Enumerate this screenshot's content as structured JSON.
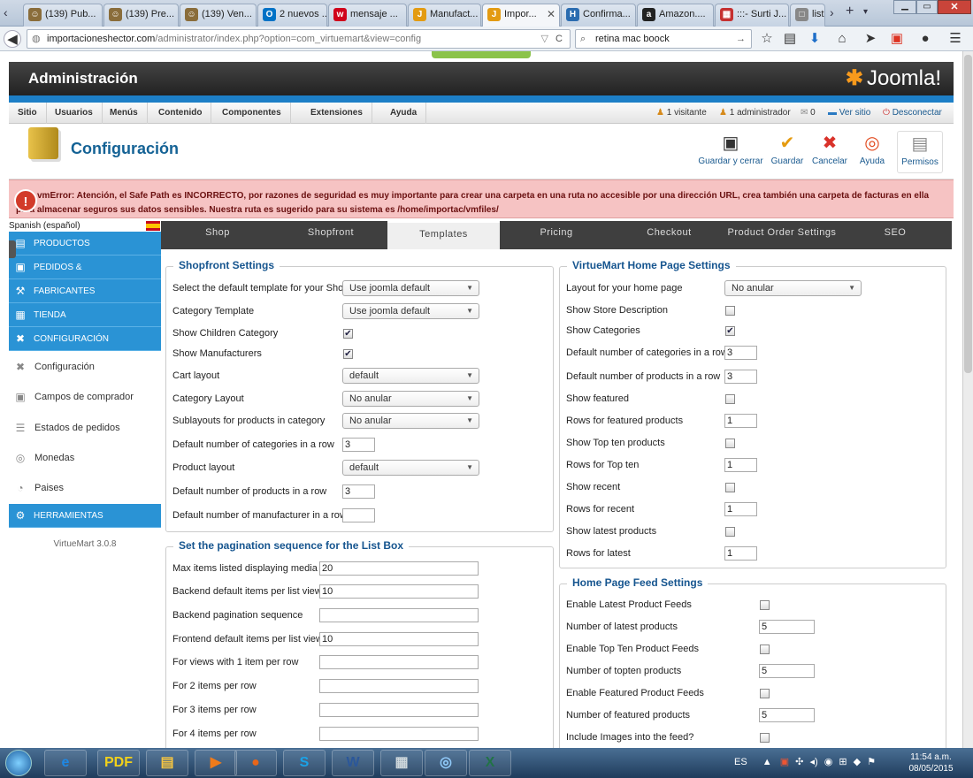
{
  "browser": {
    "tabs": [
      {
        "label": "(139) Pub...",
        "color": "#8a6d3b",
        "glyph": "☺"
      },
      {
        "label": "(139) Pre...",
        "color": "#8a6d3b",
        "glyph": "☺"
      },
      {
        "label": "(139) Ven...",
        "color": "#8a6d3b",
        "glyph": "☺"
      },
      {
        "label": "2 nuevos ...",
        "color": "#0072c6",
        "glyph": "O"
      },
      {
        "label": "mensaje ...",
        "color": "#d0021b",
        "glyph": "w"
      },
      {
        "label": "Manufact...",
        "color": "#e39b12",
        "glyph": "J"
      },
      {
        "label": "Impor...",
        "color": "#e39b12",
        "glyph": "J"
      },
      {
        "label": "Confirma...",
        "color": "#2b6cb0",
        "glyph": "H"
      },
      {
        "label": "Amazon....",
        "color": "#222",
        "glyph": "a"
      },
      {
        "label": ":::- Surti J...",
        "color": "#c53030",
        "glyph": "▦"
      },
      {
        "label": "lista",
        "color": "#888",
        "glyph": "□"
      }
    ],
    "active_tab": 6,
    "url_host": "importacioneshector.com",
    "url_path": "/administrator/index.php?option=com_virtuemart&view=config",
    "search_value": "retina mac boock"
  },
  "header": {
    "title": "Administración",
    "logo_text": "Joomla!"
  },
  "menubar": {
    "items": [
      "Sitio",
      "Usuarios",
      "Menús",
      "Contenido",
      "Componentes",
      "Extensiones",
      "Ayuda"
    ],
    "visitors": "1 visitante",
    "admins": "1 administrador",
    "messages": "0",
    "view_site": "Ver sitio",
    "logout": "Desconectar"
  },
  "toolbar": {
    "title": "Configuración",
    "buttons": [
      {
        "label": "Guardar y cerrar",
        "icon": "save-close-icon",
        "glyph": "▣",
        "color": "#333"
      },
      {
        "label": "Guardar",
        "icon": "check-icon",
        "glyph": "✔",
        "color": "#e59b10"
      },
      {
        "label": "Cancelar",
        "icon": "cancel-icon",
        "glyph": "✖",
        "color": "#d9322a"
      },
      {
        "label": "Ayuda",
        "icon": "help-icon",
        "glyph": "◎",
        "color": "#e24a1e"
      },
      {
        "label": "Permisos",
        "icon": "lock-icon",
        "glyph": "▤",
        "color": "#888"
      }
    ]
  },
  "error_text": "vmError: Atención, el Safe Path es INCORRECTO, por razones de seguridad es muy importante para crear una carpeta en una ruta no accesible por una dirección URL, crea también una carpeta de facturas en ella para almacenar seguros sus datos sensibles. Nuestra ruta es sugerido para su sistema es /home/importac/vmfiles/",
  "sidebar": {
    "language": "Spanish (español)",
    "sections": [
      {
        "label": "PRODUCTOS",
        "icon": "products-icon",
        "glyph": "▤"
      },
      {
        "label": "PEDIDOS &",
        "icon": "orders-icon",
        "glyph": "▣"
      },
      {
        "label": "FABRICANTES",
        "icon": "wrench-icon",
        "glyph": "⚒"
      },
      {
        "label": "TIENDA",
        "icon": "store-icon",
        "glyph": "▦"
      },
      {
        "label": "CONFIGURACIÓN",
        "icon": "config-icon",
        "glyph": "✖"
      }
    ],
    "subitems": [
      {
        "label": "Configuración",
        "icon": "tools-icon",
        "glyph": "✖"
      },
      {
        "label": "Campos de comprador",
        "icon": "fields-icon",
        "glyph": "▣"
      },
      {
        "label": "Estados de pedidos",
        "icon": "status-icon",
        "glyph": "☰"
      },
      {
        "label": "Monedas",
        "icon": "coins-icon",
        "glyph": "◎"
      },
      {
        "label": "Paises",
        "icon": "globe-icon",
        "glyph": "◔"
      }
    ],
    "tools": {
      "label": "HERRAMIENTAS",
      "icon": "tools-section-icon",
      "glyph": "⚙"
    },
    "version": "VirtueMart 3.0.8"
  },
  "tabs": [
    "Shop",
    "Shopfront",
    "Templates",
    "Pricing",
    "Checkout",
    "Product Order Settings",
    "SEO"
  ],
  "active_content_tab": 2,
  "shopfront": {
    "legend": "Shopfront Settings",
    "rows": [
      {
        "label": "Select the default template for your Shop",
        "type": "select",
        "value": "Use joomla default"
      },
      {
        "label": "Category Template",
        "type": "select",
        "value": "Use joomla default"
      },
      {
        "label": "Show Children Category",
        "type": "checkbox",
        "checked": true
      },
      {
        "label": "Show Manufacturers",
        "type": "checkbox",
        "checked": true
      },
      {
        "label": "Cart layout",
        "type": "select",
        "value": "default"
      },
      {
        "label": "Category Layout",
        "type": "select",
        "value": "No anular"
      },
      {
        "label": "Sublayouts for products in category",
        "type": "select",
        "value": "No anular"
      },
      {
        "label": "Default number of categories in a row",
        "type": "input",
        "value": "3"
      },
      {
        "label": "Product layout",
        "type": "select",
        "value": "default"
      },
      {
        "label": "Default number of products in a row",
        "type": "input",
        "value": "3"
      },
      {
        "label": "Default number of manufacturer in a row",
        "type": "input",
        "value": ""
      }
    ]
  },
  "pagination": {
    "legend": "Set the pagination sequence for the List Box",
    "rows": [
      {
        "label": "Max items listed displaying media",
        "value": "20"
      },
      {
        "label": "Backend default items per list view",
        "value": "10"
      },
      {
        "label": "Backend pagination sequence",
        "value": ""
      },
      {
        "label": "Frontend default items per list view",
        "value": "10"
      },
      {
        "label": "For views with 1 item per row",
        "value": ""
      },
      {
        "label": "For 2 items per row",
        "value": ""
      },
      {
        "label": "For 3 items per row",
        "value": ""
      },
      {
        "label": "For 4 items per row",
        "value": ""
      }
    ]
  },
  "homepage": {
    "legend": "VirtueMart Home Page Settings",
    "rows": [
      {
        "label": "Layout for your home page",
        "type": "select",
        "value": "No anular"
      },
      {
        "label": "Show Store Description",
        "type": "checkbox",
        "checked": false
      },
      {
        "label": "Show Categories",
        "type": "checkbox",
        "checked": true
      },
      {
        "label": "Default number of categories in a row",
        "type": "input",
        "value": "3"
      },
      {
        "label": "Default number of products in a row",
        "type": "input",
        "value": "3"
      },
      {
        "label": "Show featured",
        "type": "checkbox",
        "checked": false
      },
      {
        "label": "Rows for featured products",
        "type": "input",
        "value": "1"
      },
      {
        "label": "Show Top ten products",
        "type": "checkbox",
        "checked": false
      },
      {
        "label": "Rows for Top ten",
        "type": "input",
        "value": "1"
      },
      {
        "label": "Show recent",
        "type": "checkbox",
        "checked": false
      },
      {
        "label": "Rows for recent",
        "type": "input",
        "value": "1"
      },
      {
        "label": "Show latest products",
        "type": "checkbox",
        "checked": false
      },
      {
        "label": "Rows for latest",
        "type": "input",
        "value": "1"
      }
    ]
  },
  "feed": {
    "legend": "Home Page Feed Settings",
    "rows": [
      {
        "label": "Enable Latest Product Feeds",
        "type": "checkbox",
        "checked": false
      },
      {
        "label": "Number of latest products",
        "type": "input",
        "value": "5"
      },
      {
        "label": "Enable Top Ten Product Feeds",
        "type": "checkbox",
        "checked": false
      },
      {
        "label": "Number of topten products",
        "type": "input",
        "value": "5"
      },
      {
        "label": "Enable Featured Product Feeds",
        "type": "checkbox",
        "checked": false
      },
      {
        "label": "Number of featured products",
        "type": "input",
        "value": "5"
      },
      {
        "label": "Include Images into the feed?",
        "type": "checkbox",
        "checked": false
      }
    ]
  },
  "taskbar": {
    "apps": [
      {
        "name": "ie-icon",
        "glyph": "e",
        "color": "#1e88e5"
      },
      {
        "name": "pdf-cad-icon",
        "glyph": "PDF",
        "color": "#f2d11a"
      },
      {
        "name": "explorer-icon",
        "glyph": "▤",
        "color": "#f5c542"
      },
      {
        "name": "media-player-icon",
        "glyph": "▶",
        "color": "#f07b1a"
      },
      {
        "name": "firefox-icon",
        "glyph": "●",
        "color": "#e8661a"
      },
      {
        "name": "skype-icon",
        "glyph": "S",
        "color": "#1aa3e8"
      },
      {
        "name": "word-icon",
        "glyph": "W",
        "color": "#2b579a"
      },
      {
        "name": "calculator-icon",
        "glyph": "▦",
        "color": "#cfd8dc"
      },
      {
        "name": "app-icon",
        "glyph": "◎",
        "color": "#90caf9"
      },
      {
        "name": "excel-icon",
        "glyph": "X",
        "color": "#217346"
      }
    ],
    "lang": "ES",
    "time": "11:54 a.m.",
    "date": "08/05/2015"
  }
}
